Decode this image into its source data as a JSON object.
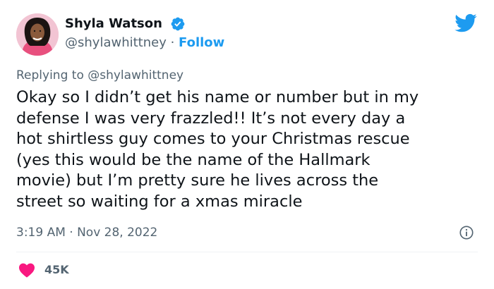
{
  "colors": {
    "accent": "#1d9bf0",
    "text_primary": "#0f1419",
    "text_secondary": "#536471",
    "like": "#f91880",
    "verified": "#1d9bf0"
  },
  "author": {
    "display_name": "Shyla Watson",
    "handle": "@shylawhittney",
    "separator": " · ",
    "follow_label": "Follow",
    "verified_icon": "verified-badge-icon",
    "avatar": "avatar"
  },
  "header": {
    "logo_icon": "twitter-bird-icon"
  },
  "tweet": {
    "reply_to": "Replying to @shylawhittney",
    "text": "Okay so I didn’t get his name or number but in my\ndefense I was very frazzled!! It’s not every day a\nhot shirtless guy comes to your Christmas rescue\n(yes this would be the name of the Hallmark\nmovie) but I’m pretty sure he lives across the\nstreet so waiting for a xmas miracle",
    "timestamp": "3:19 AM · Nov 28, 2022",
    "info_icon": "info-icon"
  },
  "engagement": {
    "like_icon": "heart-icon",
    "like_count": "45K"
  }
}
